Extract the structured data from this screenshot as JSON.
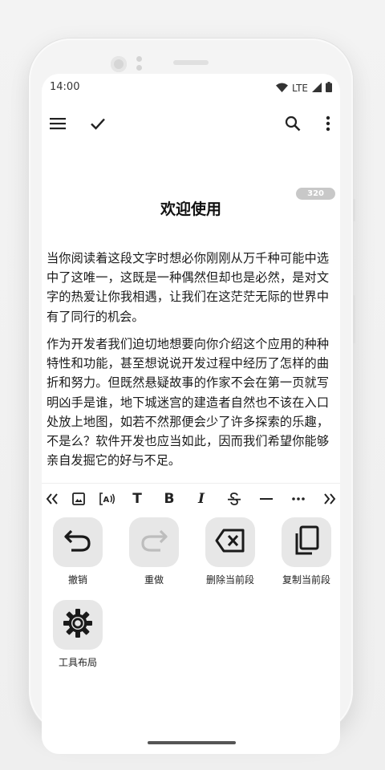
{
  "status_bar": {
    "time": "14:00",
    "network": "LTE",
    "icons": [
      "wifi-icon",
      "signal-icon",
      "battery-icon"
    ]
  },
  "toolbar": {
    "menu_icon": "menu-icon",
    "done_icon": "check-icon",
    "search_icon": "search-icon",
    "more_icon": "more-vertical-icon"
  },
  "document": {
    "char_count": "320",
    "title": "欢迎使用",
    "paragraphs": [
      "当你阅读着这段文字时想必你刚刚从万千种可能中选中了这唯一，这既是一种偶然但却也是必然，是对文字的热爱让你我相遇，让我们在这茫茫无际的世界中有了同行的机会。",
      "作为开发者我们迫切地想要向你介绍这个应用的种种特性和功能，甚至想说说开发过程中经历了怎样的曲折和努力。但既然悬疑故事的作家不会在第一页就写明凶手是谁，地下城迷宫的建造者自然也不该在入口处放上地图，如若不然那便会少了许多探索的乐趣，不是么？软件开发也应当如此，因而我们希望你能够亲自发掘它的好与不足。"
    ]
  },
  "format_bar": {
    "items": [
      {
        "icon": "double-chevron-left-icon"
      },
      {
        "icon": "image-icon"
      },
      {
        "icon": "text-to-speech-icon"
      },
      {
        "icon": "title-icon",
        "label": "T"
      },
      {
        "icon": "bold-icon",
        "label": "B"
      },
      {
        "icon": "italic-icon",
        "label": "I"
      },
      {
        "icon": "strikethrough-icon"
      },
      {
        "icon": "horizontal-rule-icon"
      },
      {
        "icon": "more-horizontal-icon"
      },
      {
        "icon": "double-chevron-right-icon"
      }
    ]
  },
  "actions": [
    {
      "label": "撤销",
      "icon": "undo-icon",
      "enabled": true
    },
    {
      "label": "重做",
      "icon": "redo-icon",
      "enabled": false
    },
    {
      "label": "删除当前段",
      "icon": "backspace-icon",
      "enabled": true
    },
    {
      "label": "复制当前段",
      "icon": "copy-icon",
      "enabled": true
    },
    {
      "label": "工具布局",
      "icon": "settings-icon",
      "enabled": true
    }
  ],
  "colors": {
    "screen_bg": "#ffffff",
    "tile_bg": "#e7e7e7",
    "disabled_icon": "#bdbdbd",
    "text": "#1a1a1a",
    "badge_bg": "#c8c8c8"
  }
}
